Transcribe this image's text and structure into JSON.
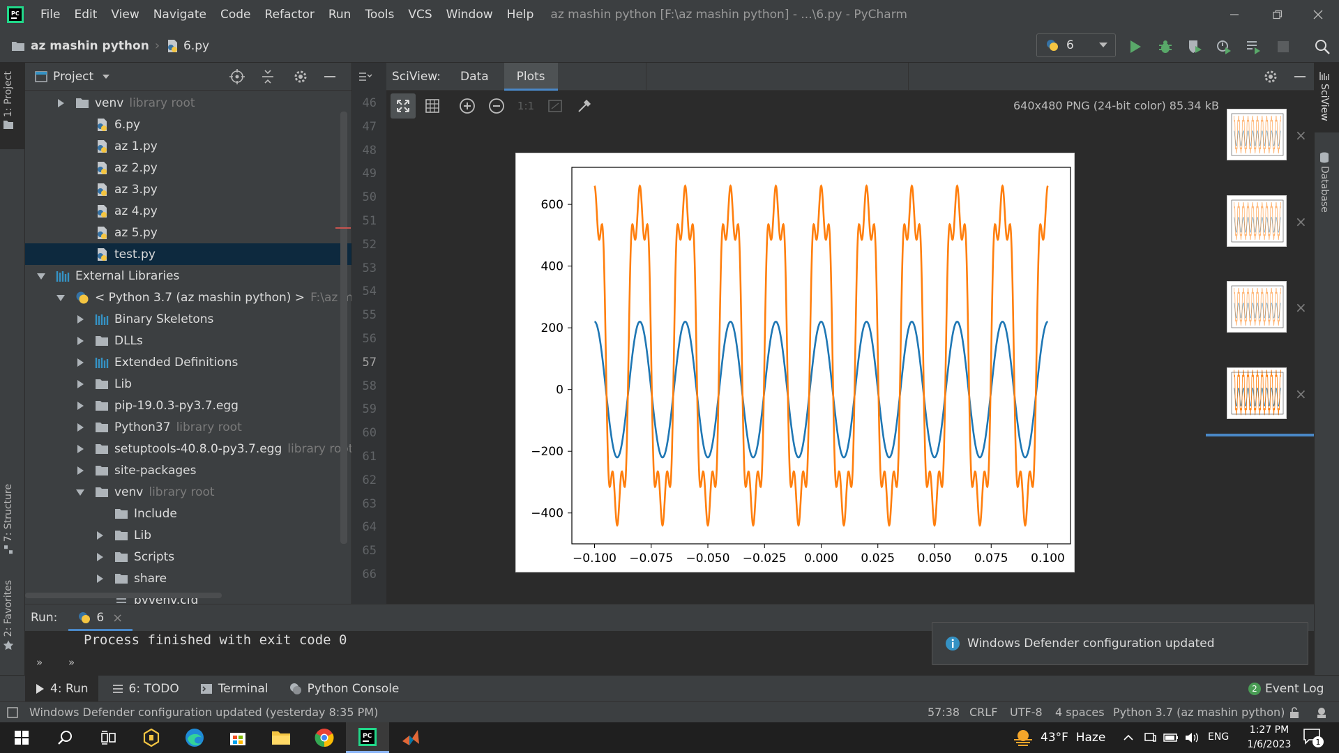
{
  "menu": {
    "items": [
      "File",
      "Edit",
      "View",
      "Navigate",
      "Code",
      "Refactor",
      "Run",
      "Tools",
      "VCS",
      "Window",
      "Help"
    ],
    "window_title": "az mashin python [F:\\az mashin python] - ...\\6.py - PyCharm"
  },
  "navbar": {
    "project_crumb": "az mashin python",
    "file_crumb": "6.py",
    "run_config": "6"
  },
  "left_stripe": {
    "project_tab": "1: Project",
    "structure_tab": "7: Structure",
    "favorites_tab": "2: Favorites"
  },
  "right_stripe": {
    "sciview_tab": "SciView",
    "database_tab": "Database"
  },
  "project_panel": {
    "title": "Project",
    "tree": [
      {
        "label": "venv",
        "hint": "library root"
      },
      {
        "label": "6.py"
      },
      {
        "label": "az 1.py"
      },
      {
        "label": "az 2.py"
      },
      {
        "label": "az 3.py"
      },
      {
        "label": "az 4.py"
      },
      {
        "label": "az 5.py"
      },
      {
        "label": "test.py"
      },
      {
        "label": "External Libraries"
      },
      {
        "label": "< Python 3.7 (az mashin python) >",
        "hint": "F:\\az mashin p"
      },
      {
        "label": "Binary Skeletons"
      },
      {
        "label": "DLLs"
      },
      {
        "label": "Extended Definitions"
      },
      {
        "label": "Lib"
      },
      {
        "label": "pip-19.0.3-py3.7.egg"
      },
      {
        "label": "Python37",
        "hint": "library root"
      },
      {
        "label": "setuptools-40.8.0-py3.7.egg",
        "hint": "library root"
      },
      {
        "label": "site-packages"
      },
      {
        "label": "venv",
        "hint": "library root"
      },
      {
        "label": "Include"
      },
      {
        "label": "Lib"
      },
      {
        "label": "Scripts"
      },
      {
        "label": "share"
      },
      {
        "label": "pyvenv.cfg"
      }
    ]
  },
  "gutter": {
    "line_numbers": [
      "46",
      "47",
      "48",
      "49",
      "50",
      "51",
      "52",
      "53",
      "54",
      "55",
      "56",
      "57",
      "58",
      "59",
      "60",
      "61",
      "62",
      "63",
      "64",
      "65",
      "66"
    ]
  },
  "sciview": {
    "label": "SciView:",
    "tabs": [
      "Data",
      "Plots"
    ],
    "active_tab": "Plots",
    "image_info": "640x480 PNG (24-bit color) 85.34 kB",
    "zoom_ratio_label": "1:1"
  },
  "chart_data": {
    "type": "line",
    "title": "",
    "xlabel": "",
    "ylabel": "",
    "xlim": [
      -0.11,
      0.11
    ],
    "ylim": [
      -500,
      720
    ],
    "x_ticks": [
      -0.1,
      -0.075,
      -0.05,
      -0.025,
      0.0,
      0.025,
      0.05,
      0.075,
      0.1
    ],
    "x_tick_labels": [
      "−0.100",
      "−0.075",
      "−0.050",
      "−0.025",
      "0.000",
      "0.025",
      "0.050",
      "0.075",
      "0.100"
    ],
    "y_ticks": [
      -400,
      -200,
      0,
      200,
      400,
      600
    ],
    "y_tick_labels": [
      "−400",
      "−200",
      "0",
      "200",
      "400",
      "600"
    ],
    "grid": false,
    "series": [
      {
        "color": "#1f77b4",
        "function": "220*cos(2*pi*50*t)",
        "x_range": [
          -0.1,
          0.1
        ]
      },
      {
        "color": "#ff7f0e",
        "function": "110 + 550*cos(2*pi*50*t) - 100*cos(2*pi*150*t) + 100*cos(2*pi*250*t)",
        "x_range": [
          -0.1,
          0.1
        ]
      }
    ]
  },
  "run_panel": {
    "label": "Run:",
    "tab": "6",
    "output": "Process finished with exit code 0"
  },
  "notification": {
    "text": "Windows Defender configuration updated"
  },
  "tool_windows": {
    "run": "4: Run",
    "todo": "6: TODO",
    "terminal": "Terminal",
    "console": "Python Console",
    "event_log": "Event Log",
    "event_count": "2"
  },
  "status": {
    "message": "Windows Defender configuration updated (yesterday 8:35 PM)",
    "position": "57:38",
    "line_sep": "CRLF",
    "encoding": "UTF-8",
    "indent": "4 spaces",
    "interpreter": "Python 3.7 (az mashin python)"
  },
  "taskbar": {
    "weather": "43°F  Haze",
    "lang": "ENG",
    "time": "1:27 PM",
    "date": "1/6/2023",
    "notif_count": "1"
  }
}
